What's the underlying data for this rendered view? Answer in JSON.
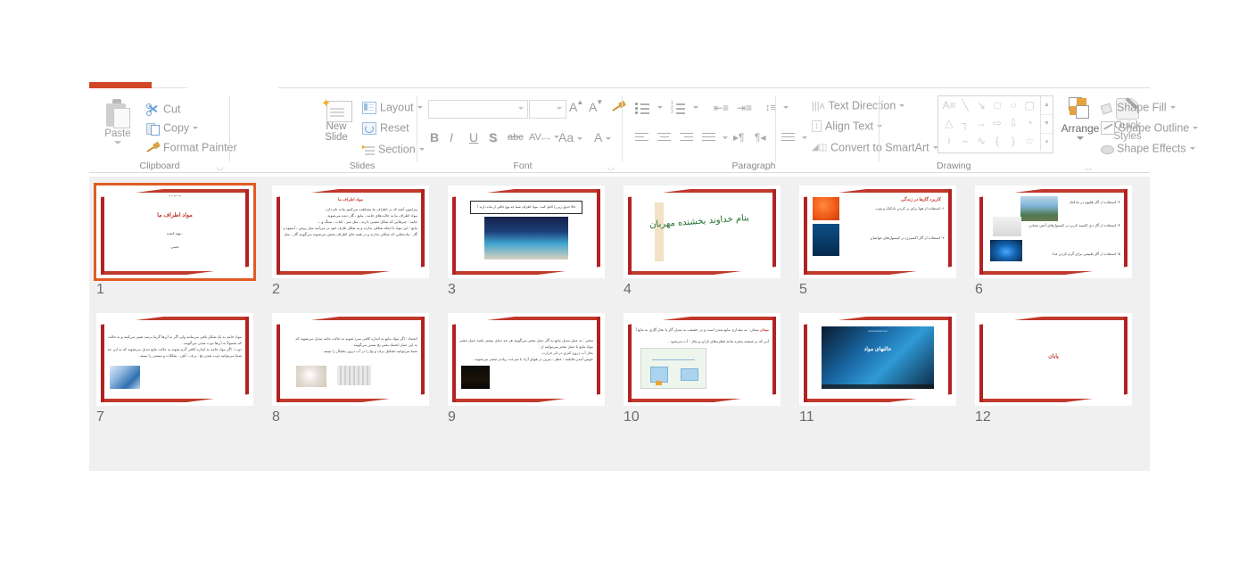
{
  "app": {
    "name": "PowerPoint",
    "active_tab_color": "#d24726",
    "view": "slide-sorter"
  },
  "ribbon": {
    "groups": [
      {
        "name": "Clipboard",
        "label": "Clipboard",
        "has_dialog_launcher": true,
        "buttons": [
          {
            "id": "paste",
            "label": "Paste",
            "icon": "paste-icon",
            "has_caret": true
          },
          {
            "id": "cut",
            "label": "Cut",
            "icon": "scissors-icon",
            "has_caret": false
          },
          {
            "id": "copy",
            "label": "Copy",
            "icon": "copy-icon",
            "has_caret": true
          },
          {
            "id": "format-painter",
            "label": "Format Painter",
            "icon": "paintbrush-icon",
            "has_caret": false
          }
        ]
      },
      {
        "name": "Slides",
        "label": "Slides",
        "has_dialog_launcher": false,
        "buttons": [
          {
            "id": "new-slide",
            "label_line1": "New",
            "label_line2": "Slide",
            "icon": "new-slide-icon",
            "has_caret": true
          },
          {
            "id": "layout",
            "label": "Layout",
            "icon": "layout-icon",
            "has_caret": true
          },
          {
            "id": "reset",
            "label": "Reset",
            "icon": "reset-icon",
            "has_caret": false
          },
          {
            "id": "section",
            "label": "Section",
            "icon": "section-icon",
            "has_caret": true
          }
        ]
      },
      {
        "name": "Font",
        "label": "Font",
        "has_dialog_launcher": true,
        "font_name_value": "",
        "font_name_placeholder": "",
        "font_size_value": "",
        "font_size_placeholder": "",
        "buttons": [
          {
            "id": "grow-font",
            "label": "A",
            "icon": "increase-font-size-icon"
          },
          {
            "id": "shrink-font",
            "label": "A",
            "icon": "decrease-font-size-icon"
          },
          {
            "id": "clear-format",
            "label": "",
            "icon": "clear-formatting-icon"
          },
          {
            "id": "bold",
            "label": "B",
            "icon": "bold-icon"
          },
          {
            "id": "italic",
            "label": "I",
            "icon": "italic-icon"
          },
          {
            "id": "underline",
            "label": "U",
            "icon": "underline-icon"
          },
          {
            "id": "shadow",
            "label": "S",
            "icon": "text-shadow-icon"
          },
          {
            "id": "strikethrough",
            "label": "abc",
            "icon": "strikethrough-icon"
          },
          {
            "id": "char-spacing",
            "label": "AV",
            "icon": "character-spacing-icon"
          },
          {
            "id": "change-case",
            "label": "Aa",
            "icon": "change-case-icon"
          },
          {
            "id": "font-color",
            "label": "A",
            "icon": "font-color-icon"
          }
        ]
      },
      {
        "name": "Paragraph",
        "label": "Paragraph",
        "has_dialog_launcher": true,
        "buttons": [
          {
            "id": "bullets",
            "label": "",
            "icon": "bullets-icon"
          },
          {
            "id": "numbering",
            "label": "",
            "icon": "numbering-icon"
          },
          {
            "id": "decrease-indent",
            "label": "",
            "icon": "decrease-indent-icon"
          },
          {
            "id": "increase-indent",
            "label": "",
            "icon": "increase-indent-icon"
          },
          {
            "id": "line-spacing",
            "label": "",
            "icon": "line-spacing-icon"
          },
          {
            "id": "align-left",
            "label": "",
            "icon": "align-left-icon"
          },
          {
            "id": "align-center",
            "label": "",
            "icon": "align-center-icon"
          },
          {
            "id": "align-right",
            "label": "",
            "icon": "align-right-icon"
          },
          {
            "id": "justify",
            "label": "",
            "icon": "justify-icon"
          },
          {
            "id": "ltr",
            "label": "",
            "icon": "left-to-right-icon"
          },
          {
            "id": "rtl",
            "label": "",
            "icon": "right-to-left-icon"
          },
          {
            "id": "columns",
            "label": "",
            "icon": "columns-icon"
          },
          {
            "id": "text-direction",
            "label": "Text Direction",
            "icon": "text-direction-icon"
          },
          {
            "id": "align-text",
            "label": "Align Text",
            "icon": "align-text-icon"
          },
          {
            "id": "convert-smartart",
            "label": "Convert to SmartArt",
            "icon": "smartart-icon"
          }
        ]
      },
      {
        "name": "Drawing",
        "label": "Drawing",
        "has_dialog_launcher": true,
        "shape_gallery": [
          [
            "textbox",
            "line",
            "arrow",
            "rectangle",
            "oval",
            "rounded-rectangle"
          ],
          [
            "triangle",
            "elbow-connector",
            "elbow-arrow-connector",
            "right-arrow",
            "down-arrow",
            "flowchart-shape"
          ],
          [
            "freeform",
            "arc",
            "curve",
            "left-brace",
            "right-brace",
            "star"
          ]
        ],
        "shape_glyphs": [
          [
            "A≡",
            "╲",
            "↘",
            "□",
            "○",
            "▢"
          ],
          [
            "△",
            "┐",
            "→",
            "⇨",
            "⇩",
            "◔"
          ],
          [
            "≀",
            "⌢",
            "∿",
            "{",
            "}",
            "☆"
          ]
        ],
        "buttons": [
          {
            "id": "arrange",
            "label": "Arrange",
            "icon": "arrange-icon",
            "has_caret": true
          },
          {
            "id": "quick-styles",
            "label_line1": "Quick",
            "label_line2": "Styles",
            "icon": "quick-styles-icon",
            "has_caret": true
          },
          {
            "id": "shape-fill",
            "label": "Shape Fill",
            "icon": "shape-fill-icon",
            "has_caret": true
          },
          {
            "id": "shape-outline",
            "label": "Shape Outline",
            "icon": "shape-outline-icon",
            "has_caret": true
          },
          {
            "id": "shape-effects",
            "label": "Shape Effects",
            "icon": "shape-effects-icon",
            "has_caret": true
          }
        ]
      }
    ]
  },
  "sorter": {
    "background": "#f0f0f0",
    "selected_slide": 1,
    "selection_color": "#e05c24",
    "slide_theme": {
      "border_color": "#b22222",
      "accent_color": "#c0392b",
      "background": "#ffffff"
    },
    "slides": [
      {
        "number": "1",
        "kind": "title",
        "top_note": "به نام خدا",
        "title": "مواد اطراف ما",
        "lines": [
          "تهیه کننده :",
          "نجمی"
        ]
      },
      {
        "number": "2",
        "kind": "text",
        "heading": "مواد اطراف ما",
        "lines": [
          "پیرامون آنچه که در اطراف ما مشاهده می‌کنیم ماده نام دارد .",
          "مواد اطراف ما به حالت‌های جامد ، مایع ، گاز دیده می‌شوند .",
          "جامد : چیزهایی که شکل معینی دارند ، مثل میز ، کتاب ، سنگ و ...",
          "مایع : این مواد با اینکه شکلی ندارند و به شکل ظرف خود در می‌آیند مثل روغن ، آبمیوه و ...",
          "گاز : ماده‌هایی که شکلی ندارند و در همه جای اطراف پخش می‌شوند می‌گویند گاز ، مثل بخار آب و ..."
        ]
      },
      {
        "number": "3",
        "kind": "callout-image",
        "callout": "حالا جدول زیر را کامل کنید ، مواد اطراف شما چه نوع حالتی از ماده دارند ؟",
        "image": "cartoon-bicycle-illustration"
      },
      {
        "number": "4",
        "kind": "calligraphy",
        "calligraphy": "بنام خداوند بخشنده مهربان"
      },
      {
        "number": "5",
        "kind": "list-with-images",
        "heading": "کاربرد گازها در زندگی",
        "lines": [
          "۱- استفاده از هوا برای پر کردن بادکنک و توپ",
          "۲- استفاده از گاز اکسیژن در کپسول‌های غواصان"
        ],
        "images": [
          "balloon-photo",
          "scuba-diver-photo"
        ]
      },
      {
        "number": "6",
        "kind": "list-with-images",
        "lines": [
          "۳- استفاده از گاز هلیوم در بادکنک",
          "۴- استفاده از گاز دی اکسید کربن در کپسول‌های آتش نشانی",
          "۵- استفاده از گاز طبیعی برای گرم کردن غذا"
        ],
        "images": [
          "stadium-dome-photo",
          "red-gas-tank-photo",
          "blue-gas-flame-photo"
        ]
      },
      {
        "number": "7",
        "kind": "text-with-image",
        "lines": [
          "مواد جامد به یک شکل باقی می‌مانند ولی اگر به آن‌ها گرما برسد تغییر می‌کنند و به حالت دیگر در می‌آیند",
          "که معمولاً به آن‌ها ذوب شدن می‌گویند .",
          "ذوب : اگر مواد جامد به اندازه کافی گرم شوند به حالت مایع تبدیل می‌شوند که به این عمل ذوب یعنی آب شدن می‌گویند .",
          "شما می‌توانید ذوب شدن یخ ، برف ، آهن ، شکلات و بستنی را ببینید ."
        ],
        "image": "ice-crystal-photo"
      },
      {
        "number": "8",
        "kind": "text-with-image",
        "lines": [
          "انجماد : اگر مواد مایع به اندازه کافی سرد شوند به حالت جامد تبدیل می‌شوند که",
          "به این عمل انجماد یعنی یخ بستن می‌گویند .",
          "شما می‌توانید تشکیل برف و یخ را در آب درون یخچال را ببینید ."
        ],
        "images": [
          "white-objects-photo",
          "ice-cube-tray-photo"
        ]
      },
      {
        "number": "9",
        "kind": "text-with-image",
        "lines": [
          "تبخیر : به عمل تبدیل مایع به گاز عمل تبخیر می‌گویند هر چه دمای بیشتر باشد عمل تبخیر سریع‌تر انجام می‌شود .",
          "مواد مایع با عمل تبخیر می‌توانند از :",
          "بخار آب درون کتری در اثر حرارت",
          "جوش آمدن قابلمه ، عطر ، بنزین در هوای آزاد با سرعت زیادتر تبخیر می‌شوند ."
        ],
        "image": "steaming-kettle-photo"
      },
      {
        "number": "10",
        "kind": "text-with-image",
        "heading_inline": "میعان",
        "lines": [
          "میعان : به مقداری مایع شدن است و در حقیقت به تبدیل گاز یا بخار گازی به مایع آن‌ها می‌گویند",
          "آبی که بر شیشه پنجره مانند قطره‌های باران و بخار - آب می‌شود ."
        ],
        "image": "distillation-diagram"
      },
      {
        "number": "11",
        "kind": "video",
        "video_title": "حالتهای مواد",
        "video_watermark": "www.tebyan.net",
        "image": "animation-video-frame"
      },
      {
        "number": "12",
        "kind": "end",
        "end_text": "پایان"
      }
    ]
  }
}
